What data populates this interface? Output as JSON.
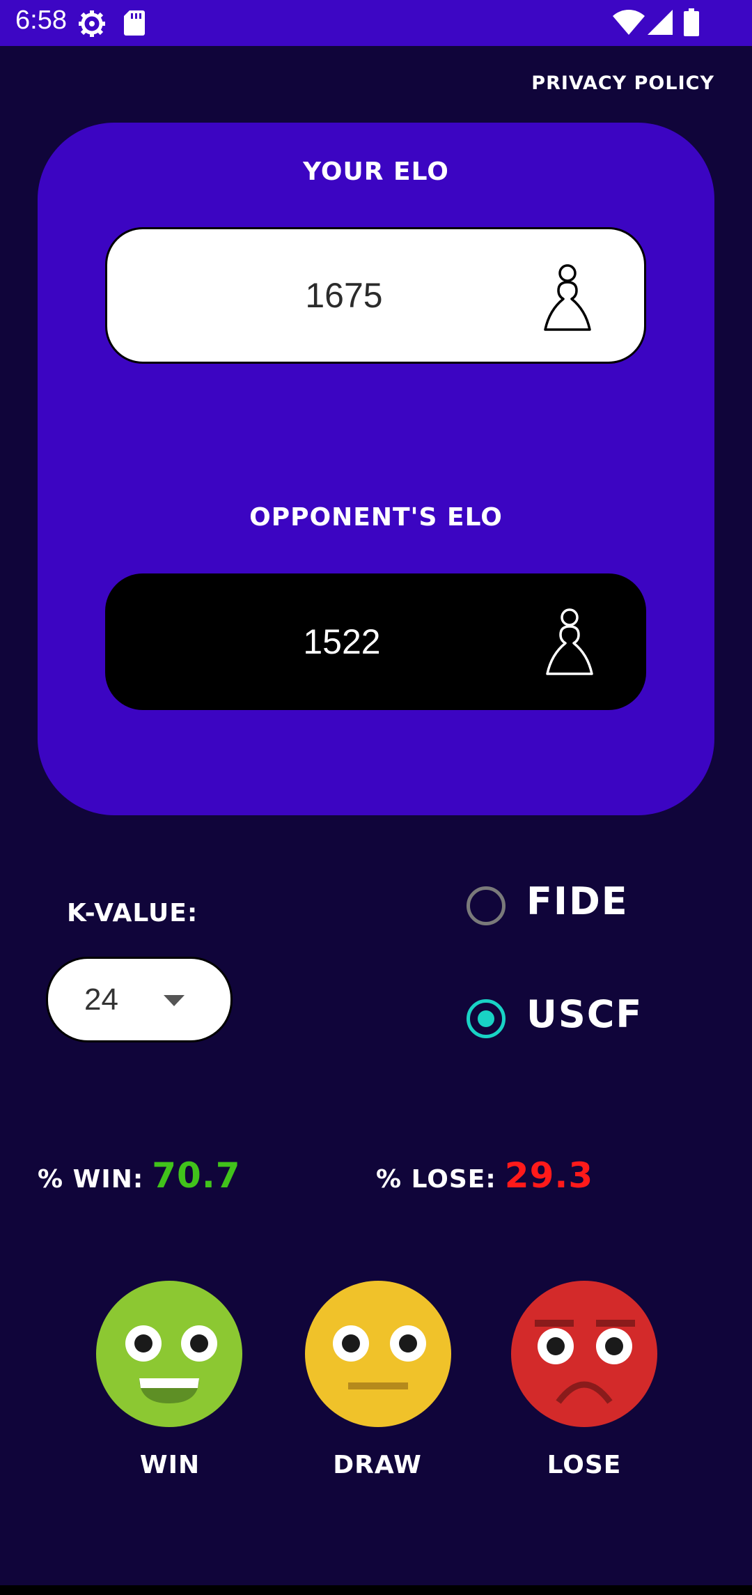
{
  "status_bar": {
    "time": "6:58",
    "left_icons": [
      "settings-gear-icon",
      "sd-card-icon"
    ],
    "right_icons": [
      "wifi-icon",
      "cell-signal-icon",
      "battery-icon"
    ],
    "color": "#3d06c4"
  },
  "header": {
    "privacy_label": "Privacy Policy"
  },
  "elo_card": {
    "your_elo_label": "Your Elo",
    "your_elo_value": "1675",
    "opponent_elo_label": "Opponent's Elo",
    "opponent_elo_value": "1522",
    "card_color": "#3c05c2"
  },
  "k_value": {
    "label": "K-value:",
    "selected": "24"
  },
  "rating_system": {
    "options": [
      {
        "label": "FIDE",
        "checked": false
      },
      {
        "label": "USCF",
        "checked": true
      }
    ],
    "accent": "#19d3c5"
  },
  "probabilities": {
    "win_label": "% Win:",
    "win_value": "70.7",
    "lose_label": "% Lose:",
    "lose_value": "29.3",
    "win_color": "#41c31b",
    "lose_color": "#ff1a1a"
  },
  "result_buttons": [
    {
      "label": "Win",
      "icon": "happy-face-icon",
      "color": "#8cc832"
    },
    {
      "label": "Draw",
      "icon": "neutral-face-icon",
      "color": "#f0c22a"
    },
    {
      "label": "Lose",
      "icon": "sad-face-icon",
      "color": "#d32a2a"
    }
  ]
}
